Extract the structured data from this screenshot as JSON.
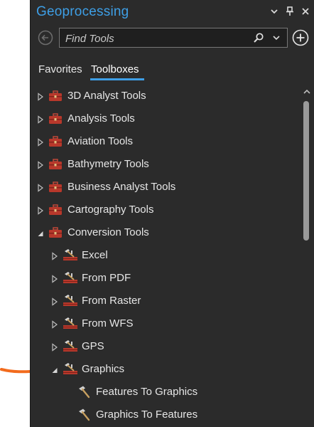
{
  "panel": {
    "title": "Geoprocessing",
    "controls": [
      "chevron-down-icon",
      "pin-icon",
      "close-icon"
    ]
  },
  "search": {
    "placeholder": "Find Tools",
    "value": ""
  },
  "tabs": [
    {
      "label": "Favorites",
      "active": false
    },
    {
      "label": "Toolboxes",
      "active": true
    }
  ],
  "tree": {
    "items": [
      {
        "label": "3D Analyst Tools",
        "level": 0,
        "state": "collapsed",
        "icon": "toolbox-icon"
      },
      {
        "label": "Analysis Tools",
        "level": 0,
        "state": "collapsed",
        "icon": "toolbox-icon"
      },
      {
        "label": "Aviation Tools",
        "level": 0,
        "state": "collapsed",
        "icon": "toolbox-icon"
      },
      {
        "label": "Bathymetry Tools",
        "level": 0,
        "state": "collapsed",
        "icon": "toolbox-icon"
      },
      {
        "label": "Business Analyst Tools",
        "level": 0,
        "state": "collapsed",
        "icon": "toolbox-icon"
      },
      {
        "label": "Cartography Tools",
        "level": 0,
        "state": "collapsed",
        "icon": "toolbox-icon"
      },
      {
        "label": "Conversion Tools",
        "level": 0,
        "state": "expanded",
        "icon": "toolbox-icon"
      },
      {
        "label": "Excel",
        "level": 1,
        "state": "collapsed",
        "icon": "toolset-icon"
      },
      {
        "label": "From PDF",
        "level": 1,
        "state": "collapsed",
        "icon": "toolset-icon"
      },
      {
        "label": "From Raster",
        "level": 1,
        "state": "collapsed",
        "icon": "toolset-icon"
      },
      {
        "label": "From WFS",
        "level": 1,
        "state": "collapsed",
        "icon": "toolset-icon"
      },
      {
        "label": "GPS",
        "level": 1,
        "state": "collapsed",
        "icon": "toolset-icon"
      },
      {
        "label": "Graphics",
        "level": 1,
        "state": "expanded",
        "icon": "toolset-icon"
      },
      {
        "label": "Features To Graphics",
        "level": 2,
        "state": "leaf",
        "icon": "tool-hammer-icon"
      },
      {
        "label": "Graphics To Features",
        "level": 2,
        "state": "leaf",
        "icon": "tool-hammer-icon"
      }
    ]
  },
  "annotation": {
    "icon": "orange-arrow-icon",
    "color": "#f26b1d"
  },
  "colors": {
    "accent": "#3e9fe6",
    "panel_bg": "#2b2b2b",
    "toolbox_red": "#b8382b"
  }
}
